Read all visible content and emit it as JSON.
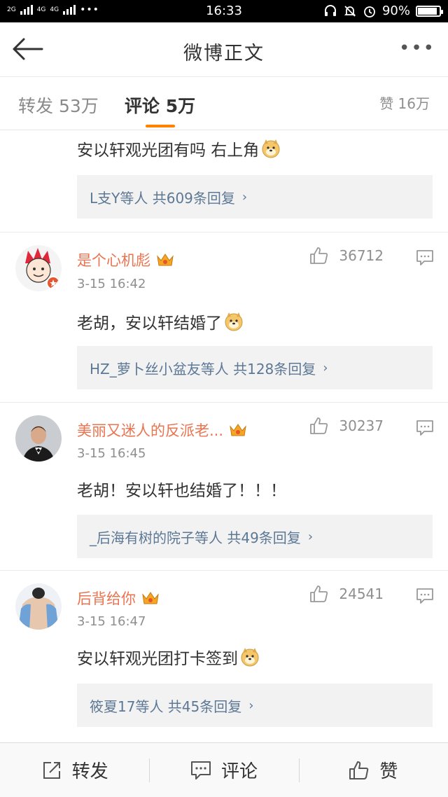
{
  "status_bar": {
    "network_1": "2G",
    "network_2": "4G",
    "network_3": "4G",
    "time": "16:33",
    "battery": "90%",
    "battery_level": 0.9
  },
  "nav": {
    "title": "微博正文"
  },
  "tabs": {
    "repost": "转发 53万",
    "comment": "评论 5万",
    "like": "赞 16万"
  },
  "top_partial": {
    "text": "安以轩观光团有吗 右上角",
    "replies": "L支Y等人  共609条回复"
  },
  "comments": [
    {
      "name": "是个心机彪",
      "time": "3-15 16:42",
      "likes": "36712",
      "text": "老胡，安以轩结婚了",
      "replies": "HZ_萝卜丝小盆友等人  共128条回复"
    },
    {
      "name": "美丽又迷人的反派老...",
      "time": "3-15 16:45",
      "likes": "30237",
      "text": "老胡！安以轩也结婚了！！！",
      "replies": "_后海有树的院子等人  共49条回复"
    },
    {
      "name": "后背给你",
      "time": "3-15 16:47",
      "likes": "24541",
      "text": "安以轩观光团打卡签到",
      "replies": "筱夏17等人  共45条回复"
    }
  ],
  "toolbar": {
    "repost": "转发",
    "comment": "评论",
    "like": "赞"
  },
  "colors": {
    "accent": "#ff8200",
    "username": "#eb7350",
    "reply_link": "#5d7895"
  }
}
